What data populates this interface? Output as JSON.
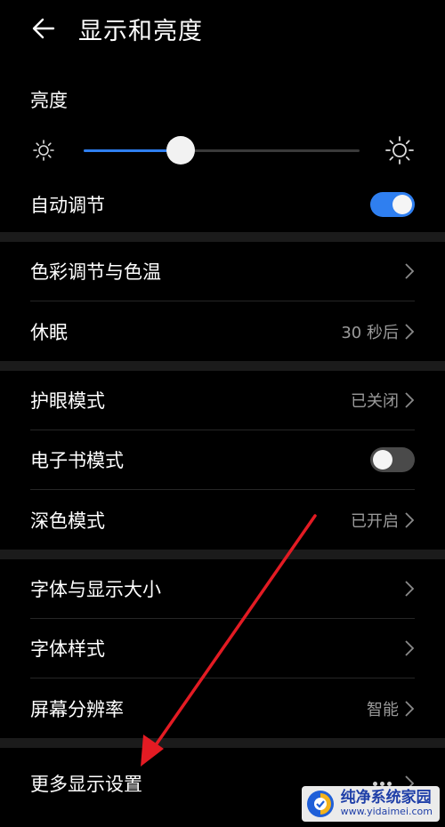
{
  "header": {
    "title": "显示和亮度"
  },
  "brightness": {
    "label": "亮度",
    "level": 0.35
  },
  "auto_adjust": {
    "label": "自动调节",
    "on": true
  },
  "section1": {
    "color": {
      "label": "色彩调节与色温"
    },
    "sleep": {
      "label": "休眠",
      "value": "30 秒后"
    }
  },
  "section2": {
    "eye": {
      "label": "护眼模式",
      "value": "已关闭"
    },
    "ebook": {
      "label": "电子书模式",
      "on": false
    },
    "dark": {
      "label": "深色模式",
      "value": "已开启"
    }
  },
  "section3": {
    "font_size": {
      "label": "字体与显示大小"
    },
    "font_style": {
      "label": "字体样式"
    },
    "resolution": {
      "label": "屏幕分辨率",
      "value": "智能"
    }
  },
  "section4": {
    "more": {
      "label": "更多显示设置"
    }
  },
  "watermark": {
    "title": "纯净系统家园",
    "url": "www.yidaimei.com"
  },
  "colors": {
    "accent": "#2f7ff0",
    "annotation_arrow": "#e31b23",
    "background": "#000000"
  }
}
